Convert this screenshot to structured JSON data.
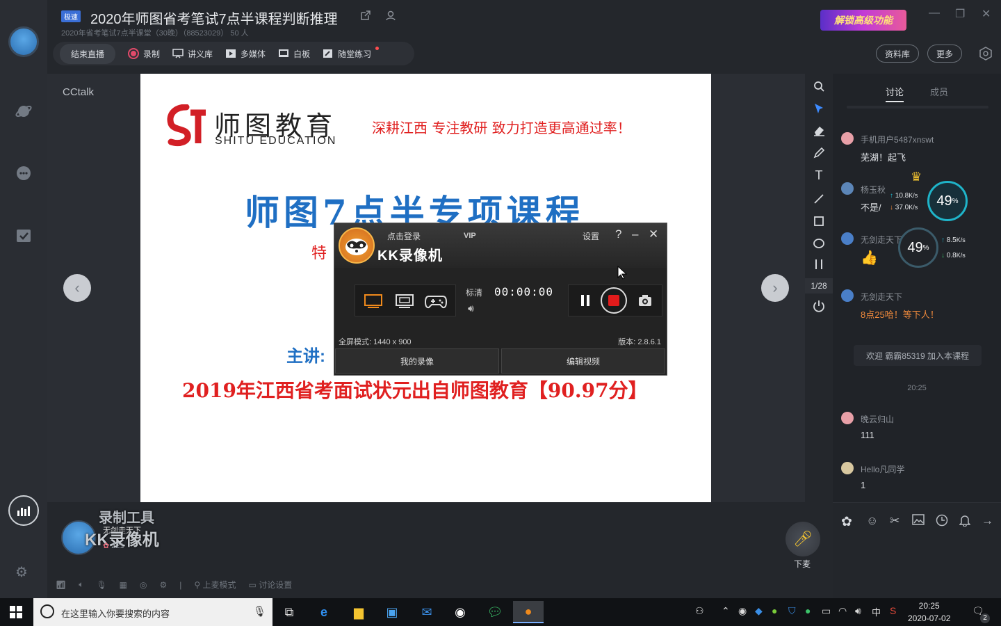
{
  "window": {
    "badge": "极速",
    "title": "2020年师图省考笔试7点半课程判断推理",
    "subtitle": "2020年省考笔试7点半课堂（30晚）（88523029）  50 人",
    "promo": "解锁高级功能",
    "colors": {
      "accent": "#1fb4c9",
      "record": "#e24a6a",
      "brand_red": "#e02020",
      "brand_blue": "#1f6fc3"
    }
  },
  "toolbar": {
    "end_live": "结束直播",
    "record": "录制",
    "lecture_lib": "讲义库",
    "multimedia": "多媒体",
    "whiteboard": "白板",
    "quiz": "随堂练习",
    "materials": "资料库",
    "more": "更多"
  },
  "stage": {
    "watermark": "CCtalk",
    "page_indicator": "1/28"
  },
  "slide": {
    "logo_cn": "师图教育",
    "logo_en": "SHITU EDUCATION",
    "slogan": "深耕江西   专注教研   致力打造更高通过率！",
    "title": "师图7点半专项课程",
    "frag_left": "特",
    "frag_bracket": "【",
    "frag_speaker": "主讲:",
    "footer": "2019年江西省考面试状元出自师图教育【90.97分】"
  },
  "recorder": {
    "login": "点击登录",
    "vip": "VIP",
    "name": "KK录像机",
    "settings": "设置",
    "help": "?",
    "minimize": "–",
    "close": "✕",
    "quality": "标清",
    "timer": "00:00:00",
    "mode": "全屏模式: 1440 x 900",
    "version": "版本: 2.8.6.1",
    "my_videos": "我的录像",
    "edit_video": "编辑视频"
  },
  "chat": {
    "tabs": [
      "讨论",
      "成员"
    ],
    "messages": [
      {
        "name": "手机用户5487xnswt",
        "text": "芜湖！起飞"
      },
      {
        "name": "杨玉秋",
        "text": "不是/"
      },
      {
        "name": "无剑走天下",
        "text": "👍"
      },
      {
        "name": "无剑走天下",
        "text": "8点25哈！等下人！"
      },
      {
        "name": "晚云归山",
        "text": "111"
      },
      {
        "name": "Hello凡同学",
        "text": "1"
      }
    ],
    "system_notice": "欢迎 霸霸85319 加入本课程",
    "time_separator": "20:25"
  },
  "speed_widgets": [
    {
      "percent": "49",
      "unit": "%",
      "up": "10.8",
      "down": "37.0",
      "rate_unit": "K/s"
    },
    {
      "percent": "49",
      "unit": "%",
      "up": "8.5",
      "down": "0.8",
      "rate_unit": "K/s"
    }
  ],
  "bottom": {
    "watermark_top": "录制工具",
    "watermark_main": "KK录像机",
    "teacher_name": "无剑走天下",
    "flower_count": "221",
    "mic_off_label": "下麦",
    "controls": [
      "上麦模式",
      "讨论设置"
    ]
  },
  "taskbar": {
    "search_placeholder": "在这里输入你要搜索的内容",
    "time": "20:25",
    "date": "2020-07-02",
    "ime": "中",
    "notification_count": "2"
  }
}
